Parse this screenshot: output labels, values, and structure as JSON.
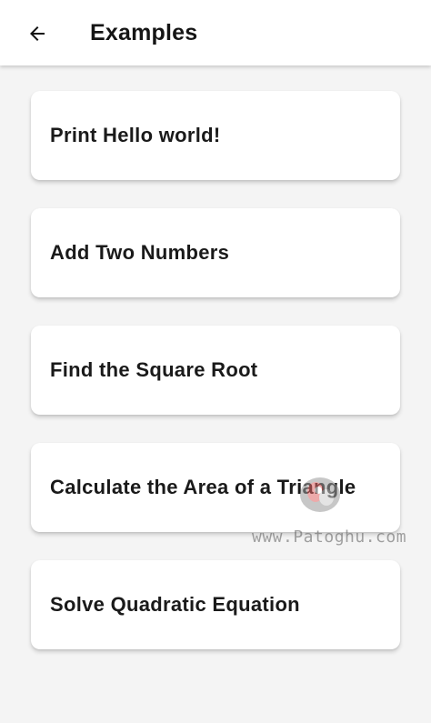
{
  "appbar": {
    "title": "Examples",
    "back_icon": "arrow-left-icon"
  },
  "examples": [
    {
      "label": "Print Hello world!"
    },
    {
      "label": "Add Two Numbers"
    },
    {
      "label": "Find the Square Root"
    },
    {
      "label": "Calculate the Area of a Triangle"
    },
    {
      "label": "Solve Quadratic Equation"
    }
  ],
  "watermark": {
    "text": "www.Patoghu.com"
  },
  "colors": {
    "background": "#f4f4f4",
    "surface": "#ffffff",
    "text": "#1a1a1a"
  }
}
